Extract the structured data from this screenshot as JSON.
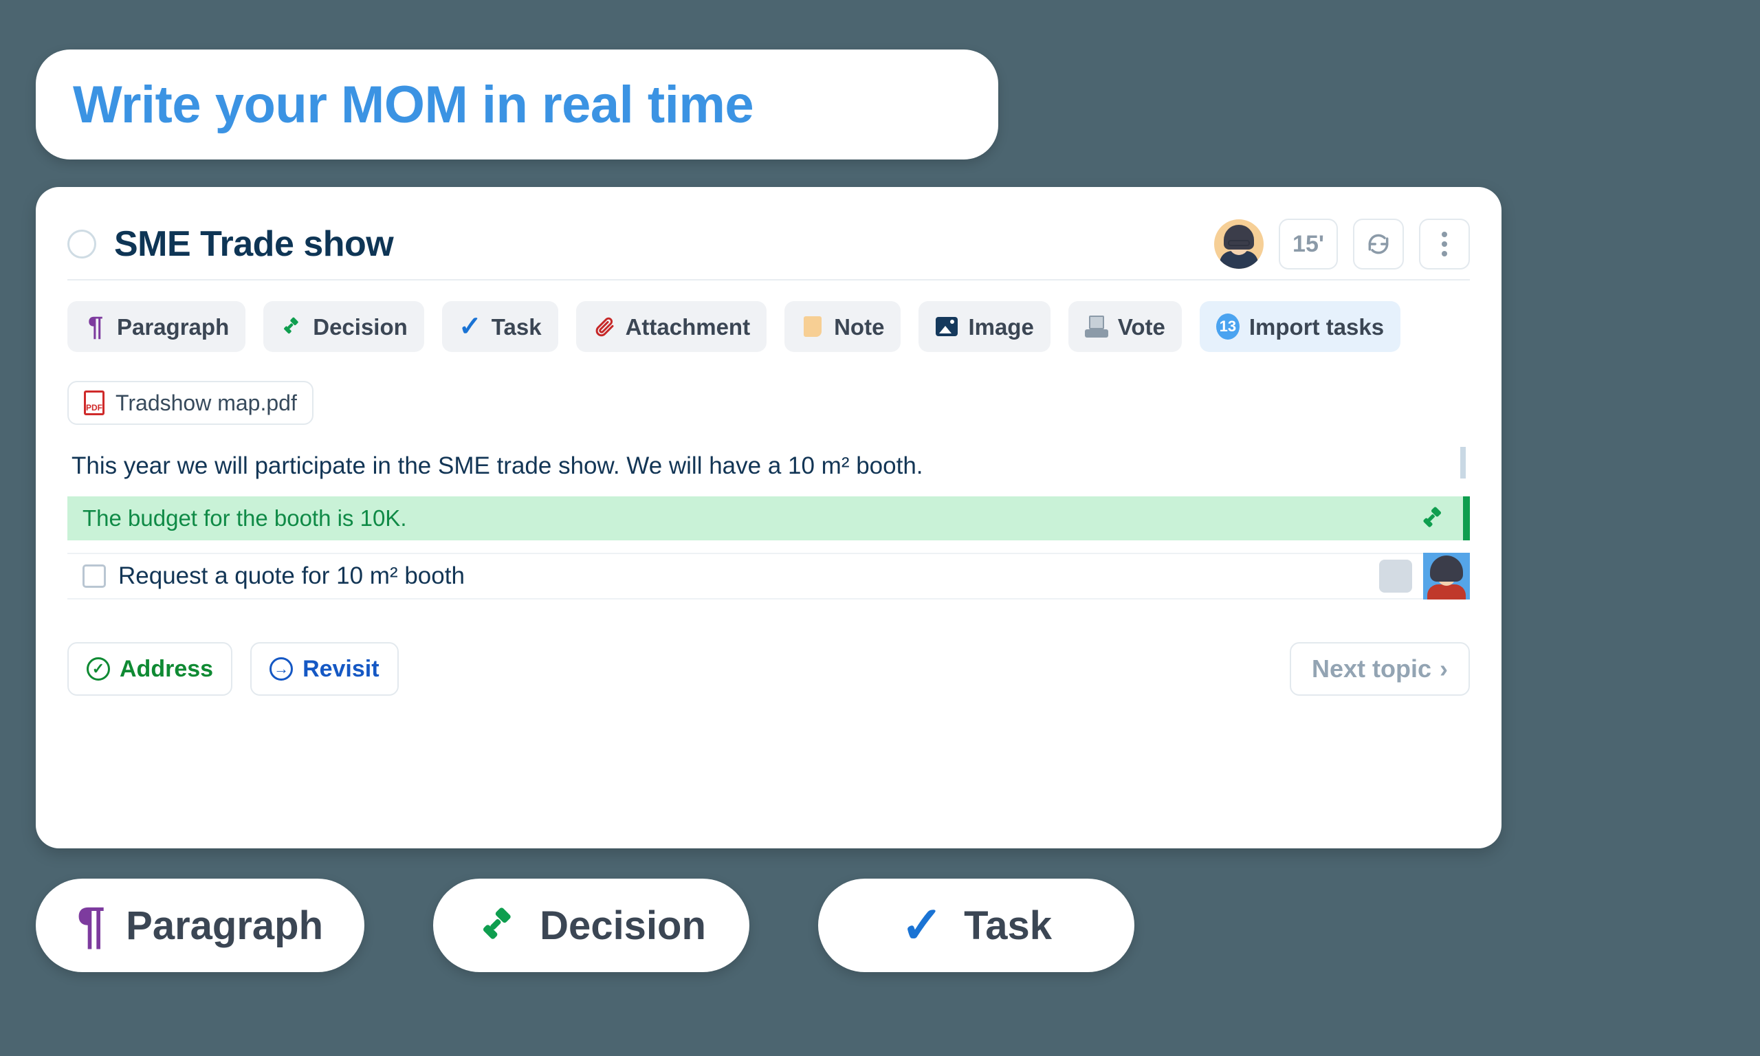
{
  "hero": {
    "title": "Write your MOM in real time",
    "color": "#3b93e3"
  },
  "card": {
    "topic_title": "SME Trade show",
    "header_controls": {
      "duration_label": "15'",
      "refresh_icon": "refresh-icon",
      "more_icon": "more-vertical-icon",
      "avatar": "avatar-facilitator"
    },
    "toolbar": [
      {
        "label": "Paragraph",
        "icon": "pilcrow-icon",
        "accent": false
      },
      {
        "label": "Decision",
        "icon": "gavel-icon",
        "accent": false
      },
      {
        "label": "Task",
        "icon": "checkmark-icon",
        "accent": false
      },
      {
        "label": "Attachment",
        "icon": "paperclip-icon",
        "accent": false
      },
      {
        "label": "Note",
        "icon": "sticky-note-icon",
        "accent": false
      },
      {
        "label": "Image",
        "icon": "image-icon",
        "accent": false
      },
      {
        "label": "Vote",
        "icon": "ballot-box-icon",
        "accent": false
      },
      {
        "label": "Import tasks",
        "icon": "badge-count-icon",
        "accent": true,
        "badge": "13"
      }
    ],
    "attachment": {
      "filename": "Tradshow map.pdf",
      "icon": "pdf-file-icon",
      "icon_label": "PDF"
    },
    "paragraph": {
      "text": "This year we will participate in the SME trade show. We will have a 10 m² booth."
    },
    "decision": {
      "text": "The budget for the booth is 10K.",
      "icon": "gavel-icon",
      "bg_color": "#c9f2d7",
      "text_color": "#0f8a46",
      "edge_color": "#0f9e4f"
    },
    "task": {
      "text": "Request a quote for 10 m² booth",
      "checked": false,
      "assignee_avatar": "avatar-assignee"
    },
    "footer": {
      "address_label": "Address",
      "address_icon": "check-circle-icon",
      "revisit_label": "Revisit",
      "revisit_icon": "arrow-right-circle-icon",
      "next_label": "Next topic",
      "next_icon": "chevron-right-icon"
    }
  },
  "pills": [
    {
      "label": "Paragraph",
      "icon": "pilcrow-icon"
    },
    {
      "label": "Decision",
      "icon": "gavel-icon"
    },
    {
      "label": "Task",
      "icon": "checkmark-icon"
    }
  ],
  "colors": {
    "background": "#4c6570",
    "brand_blue": "#3b93e3",
    "navy": "#0e3555",
    "green": "#0f8a46",
    "purple": "#7d3b9e"
  }
}
